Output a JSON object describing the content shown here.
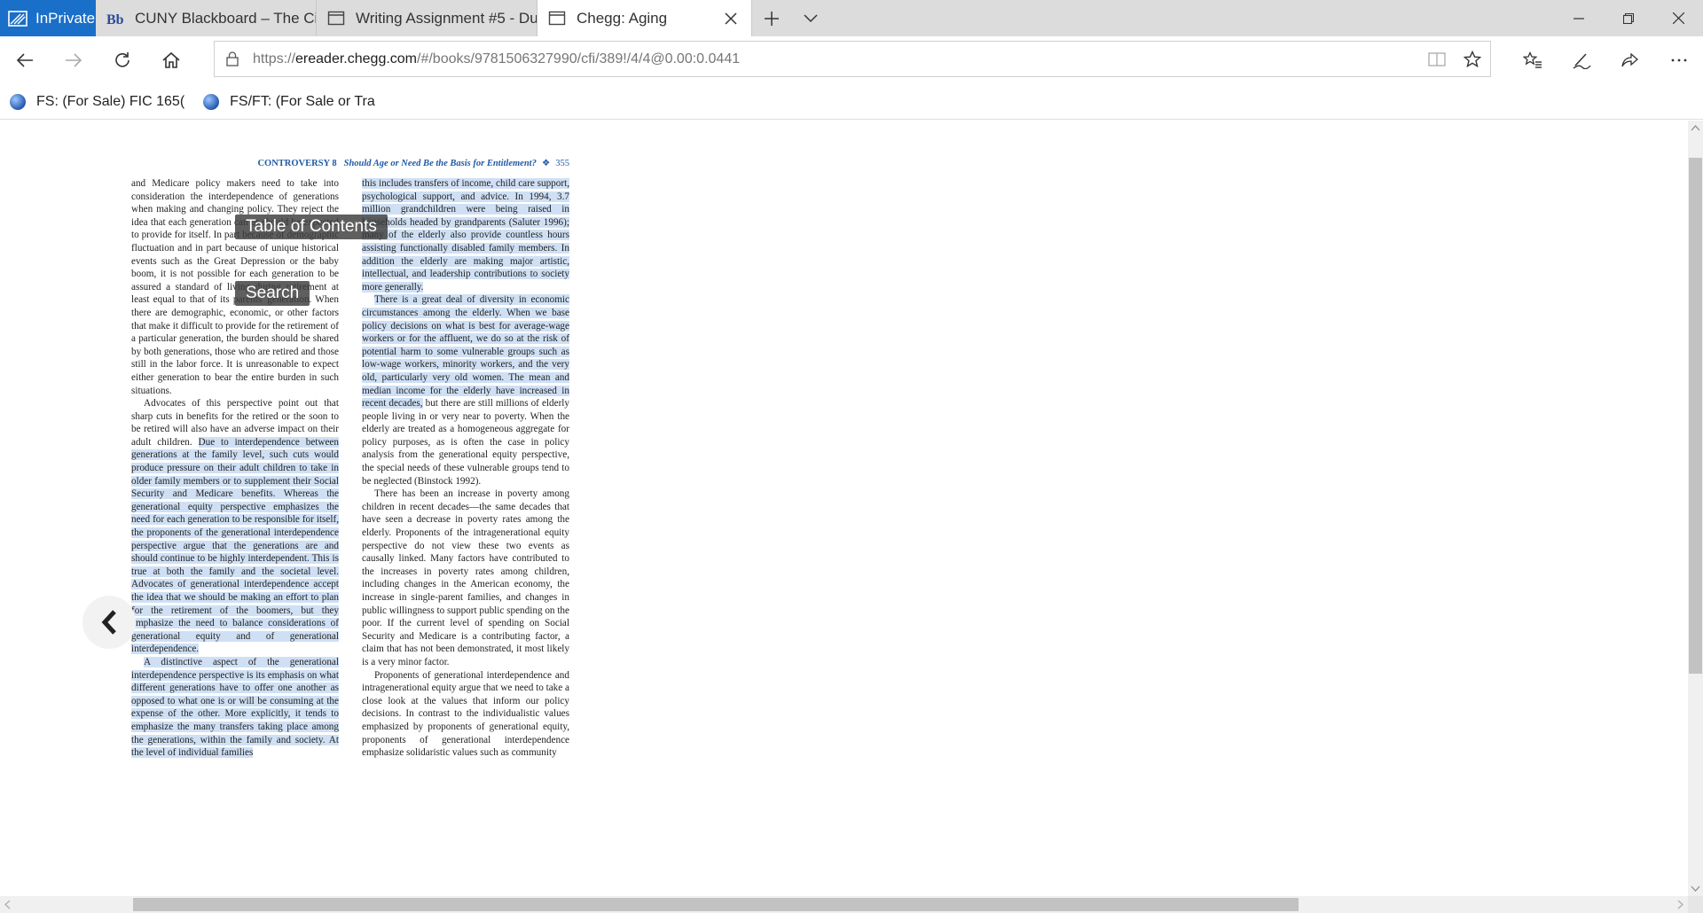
{
  "browser": {
    "inprivate_label": "InPrivate",
    "tabs": [
      {
        "title": "CUNY Blackboard – The City",
        "icon": "blackboard-icon"
      },
      {
        "title": "Writing Assignment #5 - Du",
        "icon": "page-icon"
      },
      {
        "title": "Chegg: Aging",
        "icon": "page-icon",
        "active": true
      }
    ],
    "address": {
      "scheme": "https://",
      "host": "ereader.chegg.com",
      "path": "/#/books/9781506327990/cfi/389!/4/4@0.00:0.0441"
    },
    "favorites": [
      {
        "label": "FS: (For Sale) FIC 165(",
        "icon": "globe-icon"
      },
      {
        "label": "FS/FT: (For Sale or Tra",
        "icon": "globe-icon"
      }
    ]
  },
  "reader": {
    "running_head": {
      "controversy": "CONTROVERSY 8",
      "title": "Should Age or Need Be the Basis for Entitlement?",
      "marker": "❖",
      "page": "355"
    },
    "overlay": {
      "toc_label": "Table of Contents",
      "search_label": "Search"
    },
    "left_column": [
      {
        "segments": [
          {
            "t": "and Medicare policy makers need to take into consideration the interdependence of generations when making and changing policy. They reject the idea that each generation can or should be expected to provide for itself. In part because of demographic fluctuation and in part because of unique historical events such as the Great Depression or the baby boom, it is not possible for each generation to be assured a standard of living during retirement at least equal to that of its parents' generation. When there are demographic, economic, or other factors that make it difficult to provide for the retirement of a particular generation, the burden should be shared by both generations, those who are retired and those still in the labor force. It is unreasonable to expect either generation to bear the entire burden in such situations.",
            "h": false
          }
        ]
      },
      {
        "indent": true,
        "segments": [
          {
            "t": "Advocates of this perspective point out that sharp cuts in benefits for the retired or the soon to be retired will also have an adverse impact on their adult children. ",
            "h": false
          },
          {
            "t": "Due to interdependence between generations at the family level, such cuts would produce pressure on their adult children to take in older family members or to supplement their Social Security and Medicare benefits. Whereas the generational equity perspective emphasizes the need for each generation to be responsible for itself, the proponents of the generational interdependence perspective argue that the generations are and should continue to be highly interdependent. This is true at both the family and the societal level. Advocates of generational interdependence accept the idea that we should be making an effort to plan for the retirement of the boomers, but they emphasize the need to balance considerations of generational equity and of generational interdependence.",
            "h": true
          }
        ]
      },
      {
        "indent": true,
        "segments": [
          {
            "t": "A distinctive aspect of the generational interdependence perspective is its emphasis on what different generations have to offer one another as opposed to what one is or will be consuming at the expense of the other. More explicitly, it tends to emphasize the many transfers taking place among the generations, within the family and society. At the level of individual families",
            "h": true
          }
        ]
      }
    ],
    "right_column": [
      {
        "segments": [
          {
            "t": "this includes transfers of income, child care support, psychological support, and advice. In 1994, 3.7 million grandchildren were being raised in households headed by grandparents (Saluter 1996); many of the elderly also provide countless hours assisting functionally disabled family members. In addition the elderly are making major artistic, intellectual, and leadership contributions to society more generally.",
            "h": true
          }
        ]
      },
      {
        "indent": true,
        "segments": [
          {
            "t": "There is a great deal of diversity in economic circumstances among the elderly. When we base policy decisions on what is best for average-wage workers or for the affluent, we do so at the risk of potential harm to some vulnerable groups such as low-wage workers, minority workers, and the very old, particularly very old women. The mean and median income for the elderly have increased in recent decades,",
            "h": true
          },
          {
            "t": " but there are still millions of elderly people living in or very near to poverty. When the elderly are treated as a homogeneous aggregate for policy purposes, as is often the case in policy analysis from the generational equity perspective, the special needs of these vulnerable groups tend to be neglected (Binstock 1992).",
            "h": false
          }
        ]
      },
      {
        "indent": true,
        "segments": [
          {
            "t": "There has been an increase in poverty among children in recent decades—the same decades that have seen a decrease in poverty rates among the elderly. Proponents of the intragenerational equity perspective do not view these two events as causally linked. Many factors have contributed to the increases in poverty rates among children, including changes in the American economy, the increase in single-parent families, and changes in public willingness to support public spending on the poor. If the current level of spending on Social Security and Medicare is a contributing factor, a claim that has not been demonstrated, it most likely is a very minor factor.",
            "h": false
          }
        ]
      },
      {
        "indent": true,
        "segments": [
          {
            "t": "Proponents of generational interdependence and intragenerational equity argue that we need to take a close look at the values that inform our policy decisions. In contrast to the individualistic values emphasized by proponents of generational equity, proponents of generational interdependence emphasize solidaristic values such as community",
            "h": false
          }
        ]
      }
    ]
  }
}
